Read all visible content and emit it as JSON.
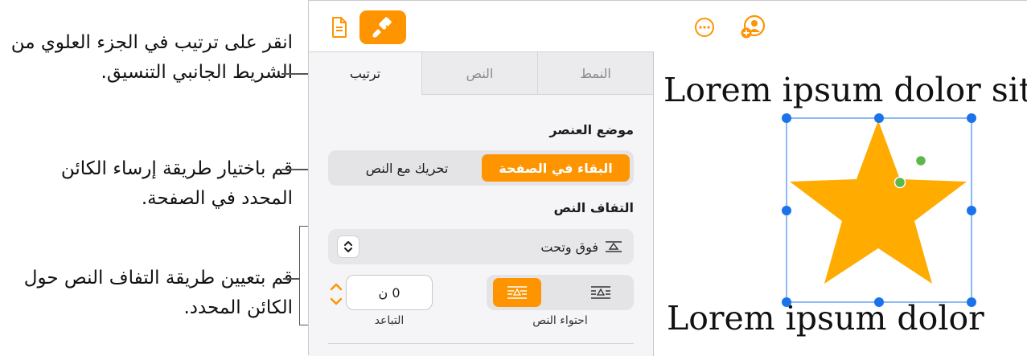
{
  "callouts": {
    "top": "انقر على ترتيب في الجزء العلوي من الشريط الجانبي التنسيق.",
    "anchor": "قم باختيار طريقة إرساء الكائن المحدد في الصفحة.",
    "wrap": "قم بتعيين طريقة التفاف النص حول الكائن المحدد."
  },
  "toolbar": {
    "document_icon": "document-icon",
    "format_icon": "paintbrush-icon",
    "more_icon": "ellipsis-circle-icon",
    "collaborate_icon": "person-add-icon"
  },
  "sidebar": {
    "tabs": [
      {
        "label": "ترتيب",
        "active": true
      },
      {
        "label": "النص",
        "active": false
      },
      {
        "label": "النمط",
        "active": false
      }
    ],
    "object_placement": {
      "title": "موضع العنصر",
      "stay_on_page": "البقاء في الصفحة",
      "move_with_text": "تحريك مع النص",
      "selected": "stay_on_page"
    },
    "text_wrap": {
      "title": "التفاف النص",
      "selected_value": "فوق وتحت",
      "fit_label": "احتواء النص",
      "spacing_label": "التباعد",
      "spacing_value": "0 ن"
    }
  },
  "canvas": {
    "line1": "Lorem ipsum dolor sit",
    "line2": "Lorem ipsum dolor"
  },
  "colors": {
    "accent": "#fe9400",
    "selection": "#1a73e8",
    "star": "#ffab00",
    "rotate_handle": "#5cb84a"
  }
}
